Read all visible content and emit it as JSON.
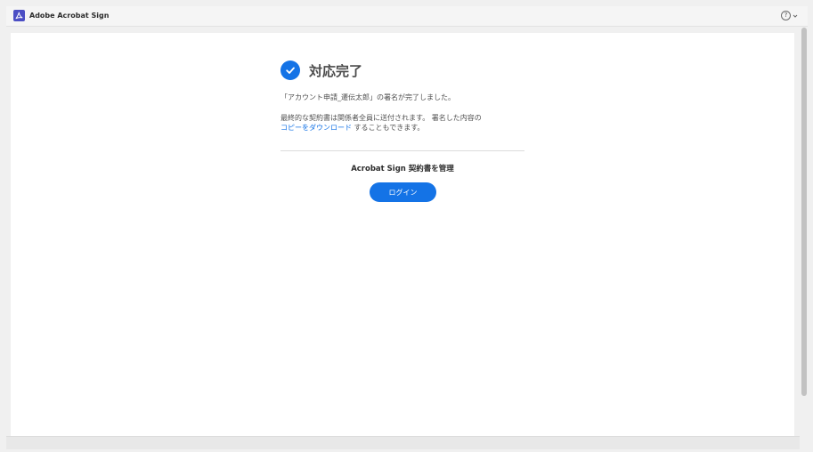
{
  "app": {
    "title": "Adobe Acrobat Sign",
    "logo_icon": "acrobat-logo-icon",
    "help_icon": "question-circle-icon",
    "help_glyph": "?",
    "brand_color": "#4b4ec4"
  },
  "panel": {
    "title": "対応完了",
    "status_icon": "checkmark-circle-icon",
    "message_1": "「アカウント申請_遷伝太郎」の署名が完了しました。",
    "message_2_line1": "最終的な契約書は関係者全員に送付されます。 署名した内容の",
    "message_2_link": "コピーをダウンロード",
    "message_2_rest": " することもできます。",
    "manage_label": "Acrobat Sign 契約書を管理",
    "login_button": "ログイン",
    "accent_color": "#1473e6"
  }
}
